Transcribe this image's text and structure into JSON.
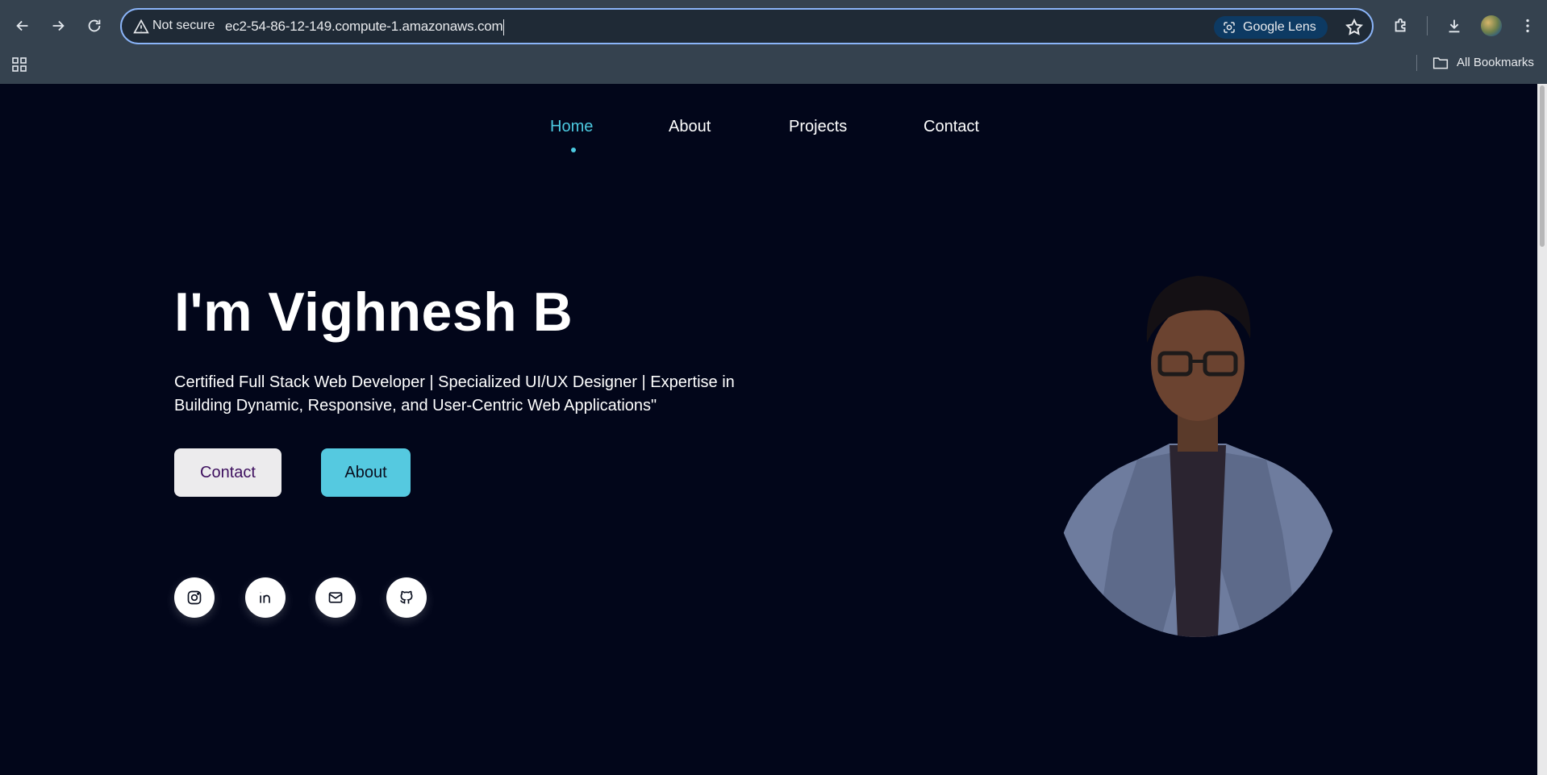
{
  "browser": {
    "security_label": "Not secure",
    "url": "ec2-54-86-12-149.compute-1.amazonaws.com",
    "lens_label": "Google Lens",
    "bookmarks_label": "All Bookmarks"
  },
  "site": {
    "nav": [
      {
        "label": "Home",
        "active": true
      },
      {
        "label": "About",
        "active": false
      },
      {
        "label": "Projects",
        "active": false
      },
      {
        "label": "Contact",
        "active": false
      }
    ],
    "accent_color": "#4cc9e0",
    "background_color": "#02061a"
  },
  "hero": {
    "title": "I'm Vighnesh B",
    "subtitle": "Certified Full Stack Web Developer | Specialized UI/UX Designer | Expertise in Building Dynamic, Responsive, and User-Centric Web Applications\"",
    "contact_button": "Contact",
    "about_button": "About",
    "social_icons": [
      "instagram-icon",
      "linkedin-icon",
      "mail-icon",
      "github-icon"
    ]
  }
}
